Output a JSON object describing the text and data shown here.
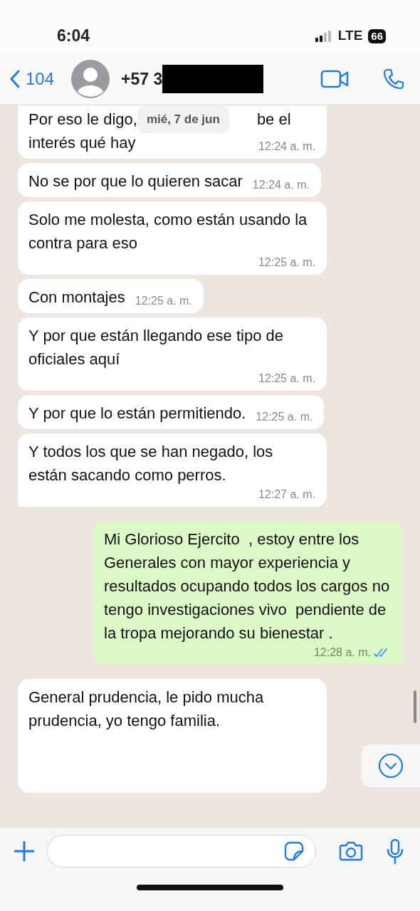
{
  "status_bar": {
    "time": "6:04",
    "network": "LTE",
    "battery": "66"
  },
  "header": {
    "back_count": "104",
    "contact": "+57 3",
    "redacted": true
  },
  "date_pill": "mié, 7 de jun",
  "messages": [
    {
      "kind": "covered",
      "outgoing": false,
      "parts": [
        "Por eso le digo,",
        "be el"
      ],
      "text": "interés qué hay",
      "time": "12:24 a. m."
    },
    {
      "kind": "text",
      "outgoing": false,
      "text": "No se por que lo quieren sacar",
      "time": "12:24 a. m."
    },
    {
      "kind": "text",
      "outgoing": false,
      "text": "Solo me molesta, como están usando la contra para eso",
      "time": "12:25 a. m."
    },
    {
      "kind": "text",
      "outgoing": false,
      "text": "Con montajes",
      "time": "12:25 a. m."
    },
    {
      "kind": "text",
      "outgoing": false,
      "text": "Y por que están llegando ese tipo de oficiales aquí",
      "time": "12:25 a. m."
    },
    {
      "kind": "text",
      "outgoing": false,
      "text": "Y por que lo están permitiendo.",
      "time": "12:25 a. m."
    },
    {
      "kind": "text",
      "outgoing": false,
      "text": "Y todos los que se han negado, los están sacando como perros.",
      "time": "12:27 a. m.",
      "tail": true
    },
    {
      "kind": "text",
      "outgoing": true,
      "text": "Mi Glorioso Ejercito  , estoy entre los Generales con mayor experiencia y resultados ocupando todos los cargos no tengo investigaciones vivo  pendiente de la tropa mejorando su bienestar .",
      "time": "12:28 a. m.",
      "read": true,
      "tail": true
    },
    {
      "kind": "text",
      "outgoing": false,
      "text": "General prudencia, le pido mucha prudencia, yo tengo familia.",
      "cut": true
    }
  ]
}
